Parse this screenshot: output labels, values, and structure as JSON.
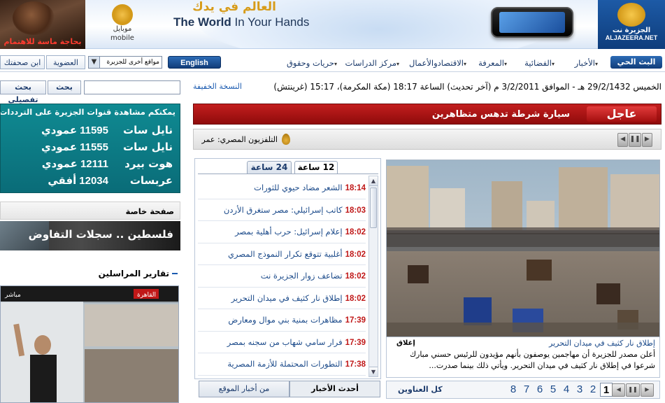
{
  "header": {
    "left_promo": "بحاجة ماسة للاهتمام",
    "ad": {
      "mobile_logo_ar": "موبايل",
      "mobile_logo_en": "mobile",
      "headline_ar": "العالم في يدك",
      "headline_en_bold": "The World",
      "headline_en_light": "In Your Hands"
    },
    "site_logo_ar": "الجزيرة نت",
    "site_logo_en": "ALJAZEERA.NET"
  },
  "nav": {
    "live": "البث الحي",
    "links": [
      "الأخبار",
      "الفضائية",
      "المعرفة",
      "الاقتصادوالأعمال",
      "مركز الدراسات",
      "حريات وحقوق"
    ],
    "english": "English",
    "other_sites": "مواقع أخرى للجزيرة",
    "membership": "العضوية",
    "ibn_sahaftak": "ابن صحفتك"
  },
  "toolbar": {
    "search_btn": "بحث",
    "adv_search": "بحث تفصيلي",
    "search_placeholder": "",
    "date_line": "الخميس 29/2/1432 هـ - الموافق 3/2/2011 م (آخر تحديث) الساعة 18:17 (مكة المكرمة)، 15:17 (غرينتش)",
    "light_version": "النسخة الخفيفة"
  },
  "breaking": {
    "tag": "عاجل",
    "text": "سيارة شرطة تدهس متظاهرين"
  },
  "ticker": {
    "text": "التلفزيون المصري: عمر"
  },
  "news_tabs": {
    "tab_12": "12 ساعة",
    "tab_24": "24 ساعة",
    "latest": "أحدث الأخبار",
    "from_site": "من أخبار الموقع"
  },
  "news_list": [
    {
      "time": "18:14",
      "title": "الشعر مضاد حيوي للثورات"
    },
    {
      "time": "18:03",
      "title": "كاتب إسرائيلي: مصر ستغرق الأردن"
    },
    {
      "time": "18:02",
      "title": "إعلام إسرائيل: حرب أهلية بمصر"
    },
    {
      "time": "18:02",
      "title": "أغلبية تتوقع تكرار النموذج المصري"
    },
    {
      "time": "18:02",
      "title": "تضاعف زوار الجزيرة نت"
    },
    {
      "time": "18:02",
      "title": "إطلاق نار كثيف في ميدان التحرير"
    },
    {
      "time": "17:39",
      "title": "مظاهرات بمنية بني موال ومعارض"
    },
    {
      "time": "17:39",
      "title": "فرار سامي شهاب من سجنه بمصر"
    },
    {
      "time": "17:38",
      "title": "التطورات المحتملة للأزمة المصرية"
    }
  ],
  "main_story": {
    "title": "إطلاق نار كثيف في ميدان التحرير",
    "close": "إغلاق",
    "description": "أعلن مصدر للجزيرة أن مهاجمين يوصفون بأنهم مؤيدون للرئيس حسني مبارك شرعوا في إطلاق نار كثيف في ميدان التحرير. ويأتي ذلك بينما صدرت..."
  },
  "pager": {
    "all_titles": "كل العناوين",
    "pages": [
      "1",
      "2",
      "3",
      "4",
      "5",
      "6",
      "7",
      "8"
    ],
    "active": "1"
  },
  "sidebar": {
    "channels_head": "يمكنكم مشاهدة قنوات الجزيرة على الترددات التالية:",
    "frequencies": [
      {
        "name": "نايل سات",
        "value": "11595",
        "unit": "عمودي"
      },
      {
        "name": "نايل سات",
        "value": "11555",
        "unit": "عمودي"
      },
      {
        "name": "هوت بيرد",
        "value": "12111",
        "unit": "عمودي"
      },
      {
        "name": "عربسات",
        "value": "12034",
        "unit": "أفقي"
      }
    ],
    "special_page": "صفحة خاصة",
    "special_banner": "فلسطين .. سجلات التفاوض",
    "reports_head": "تقارير المراسلين",
    "video_overlay": "القاهرة"
  },
  "colors": {
    "brand_blue": "#113d7a",
    "breaking_red": "#a40f0f",
    "teal": "#0a6c78",
    "time_red": "#c01818",
    "link_blue": "#1b4a8a"
  }
}
